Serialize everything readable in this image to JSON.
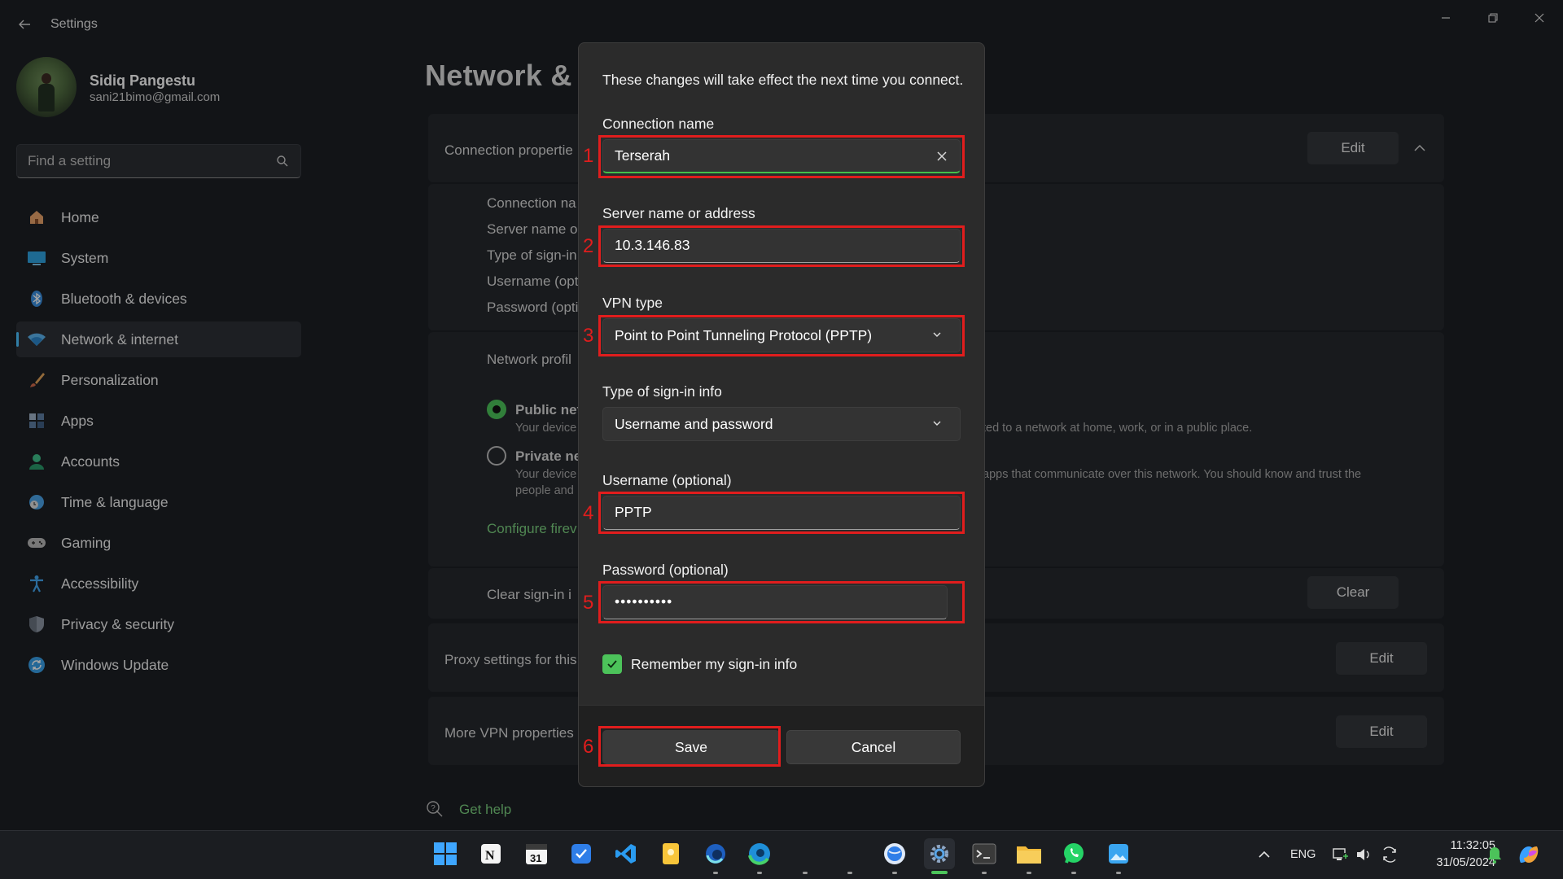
{
  "window": {
    "title": "Settings",
    "controls": [
      "minimize",
      "restore",
      "close"
    ]
  },
  "profile": {
    "name": "Sidiq Pangestu",
    "email": "sani21bimo@gmail.com"
  },
  "search": {
    "placeholder": "Find a setting"
  },
  "nav": {
    "items": [
      {
        "label": "Home",
        "icon": "home-icon",
        "color": "#e8a36b"
      },
      {
        "label": "System",
        "icon": "monitor-icon",
        "color": "#2fa3e0"
      },
      {
        "label": "Bluetooth & devices",
        "icon": "bluetooth-icon",
        "color": "#3a8fe0"
      },
      {
        "label": "Network & internet",
        "icon": "wifi-icon",
        "color": "#5bb4f0",
        "active": true
      },
      {
        "label": "Personalization",
        "icon": "brush-icon",
        "color": "#e2a35a"
      },
      {
        "label": "Apps",
        "icon": "apps-icon",
        "color": "#7fa4c8"
      },
      {
        "label": "Accounts",
        "icon": "account-icon",
        "color": "#3fc18a"
      },
      {
        "label": "Time & language",
        "icon": "globe-clock-icon",
        "color": "#4aa3e8"
      },
      {
        "label": "Gaming",
        "icon": "gamepad-icon",
        "color": "#b8b8b8"
      },
      {
        "label": "Accessibility",
        "icon": "accessibility-icon",
        "color": "#43a7f0"
      },
      {
        "label": "Privacy & security",
        "icon": "shield-icon",
        "color": "#8d96a3"
      },
      {
        "label": "Windows Update",
        "icon": "update-icon",
        "color": "#3aa0e8"
      }
    ]
  },
  "page": {
    "title": "Network & i",
    "connection_properties": "Connection propertie",
    "edit_label": "Edit",
    "props": [
      "Connection na",
      "Server name o",
      "Type of sign-in",
      "Username (opt",
      "Password (opti"
    ],
    "network_profile": "Network profil",
    "public": {
      "label": "Public net",
      "desc": "Your device",
      "desc_right": "ted to a network at home, work, or in a public place."
    },
    "private": {
      "label": "Private ne",
      "desc": "Your device",
      "desc2": "people and",
      "desc_right": "apps that communicate over this network. You should know and trust the"
    },
    "configure_firewall": "Configure firev",
    "clear_signin": "Clear sign-in i",
    "clear_label": "Clear",
    "proxy": "Proxy settings for this",
    "more_vpn": "More VPN properties",
    "get_help": "Get help"
  },
  "dialog": {
    "note": "These changes will take effect the next time you connect.",
    "connection_name": {
      "label": "Connection name",
      "value": "Terserah"
    },
    "server": {
      "label": "Server name or address",
      "value": "10.3.146.83"
    },
    "vpn_type": {
      "label": "VPN type",
      "value": "Point to Point Tunneling Protocol (PPTP)"
    },
    "signin_type": {
      "label": "Type of sign-in info",
      "value": "Username and password"
    },
    "username": {
      "label": "Username (optional)",
      "value": "PPTP"
    },
    "password": {
      "label": "Password (optional)",
      "value": "••••••••••"
    },
    "remember": {
      "label": "Remember my sign-in info",
      "checked": true
    },
    "save_label": "Save",
    "cancel_label": "Cancel"
  },
  "annotations": [
    "1",
    "2",
    "3",
    "4",
    "5",
    "6"
  ],
  "taskbar": {
    "apps": [
      {
        "name": "start-icon"
      },
      {
        "name": "notion-icon"
      },
      {
        "name": "calendar-icon"
      },
      {
        "name": "todo-icon"
      },
      {
        "name": "vscode-icon"
      },
      {
        "name": "sticky-notes-icon"
      },
      {
        "name": "edge-dev-icon"
      },
      {
        "name": "edge-icon"
      },
      {
        "name": "chrome-icon"
      },
      {
        "name": "firefox-icon"
      },
      {
        "name": "app-globe-icon"
      },
      {
        "name": "settings-icon"
      },
      {
        "name": "terminal-icon"
      },
      {
        "name": "file-explorer-icon"
      },
      {
        "name": "whatsapp-icon"
      },
      {
        "name": "photos-icon"
      }
    ],
    "calendar_day": "31",
    "language": "ENG",
    "time": "11:32:05",
    "date": "31/05/2024"
  }
}
